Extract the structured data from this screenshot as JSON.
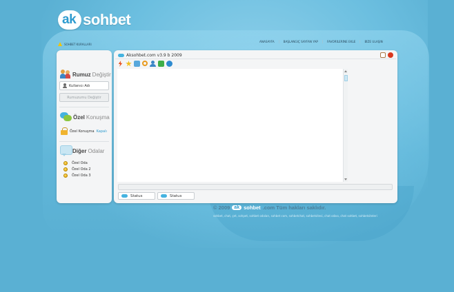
{
  "logo": {
    "part1": "ak",
    "part2": "sohbet"
  },
  "rules_link": "SOHBET KURALLARI",
  "topnav": [
    "ANASAYFA",
    "BAŞLANGIÇ SAYFAN YAP",
    "FAVORİLERİNE EKLE",
    "BİZE ULAŞIN"
  ],
  "sidebar": {
    "nick_section": {
      "title_bold": "Rumuz",
      "title_light": "Değiştir",
      "username_value": "Kullanıcı Adı",
      "change_button": "Rumuzumu Değiştir"
    },
    "private_section": {
      "title_bold": "Özel",
      "title_light": "Konuşma",
      "label": "Özel Konuşma",
      "state": "Kapalı"
    },
    "rooms_section": {
      "title_bold": "Diğer",
      "title_light": "Odalar",
      "rooms": [
        "Özel Oda",
        "Özel Oda 2",
        "Özel Oda 3"
      ]
    }
  },
  "chat_window": {
    "title": "Aksohbet.com  v3.9 b 2009",
    "status_buttons": [
      "Status",
      "Status"
    ]
  },
  "footer": {
    "copyright_prefix": "© 2009",
    "logo_part1": "ak",
    "logo_part2": "sohbet",
    "copyright_suffix": ".com   Tüm hakları saklıdır.",
    "tags": "sohbet, chat, çet, sohpet, sohbet odaları, sohbet com, sohbetchat, sohbetsitesi, chat odası, chat sohbet, sohbetsiteleri"
  },
  "colors": {
    "background": "#5ab0d3",
    "accent": "#2e9bcf",
    "panel": "#f4f5f6"
  }
}
